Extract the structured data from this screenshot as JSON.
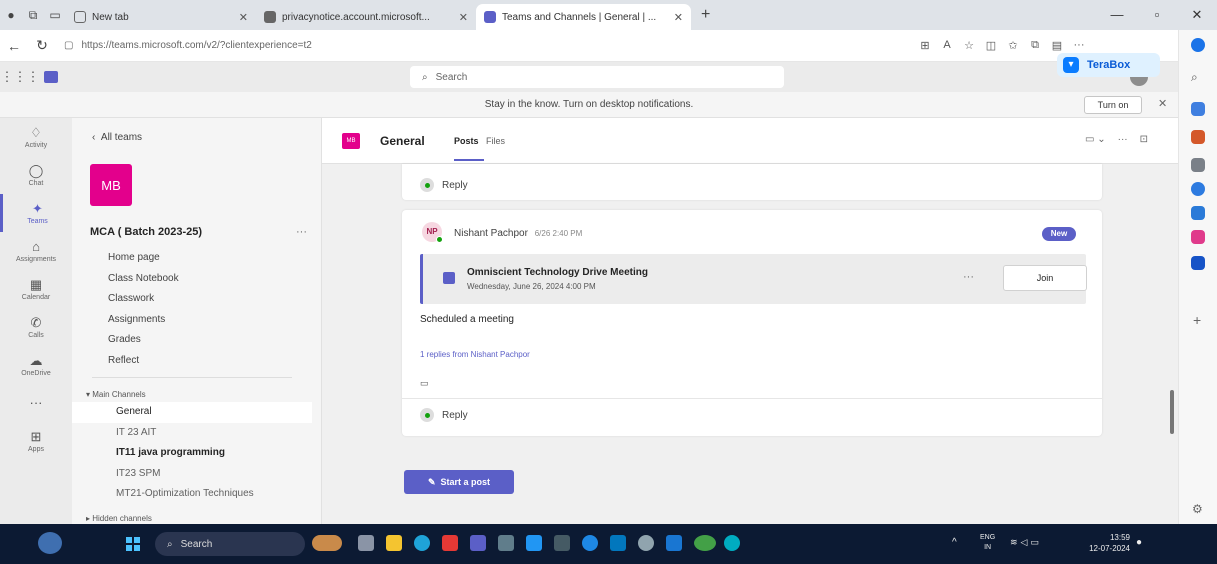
{
  "browser": {
    "tabs": [
      {
        "label": "New tab",
        "active": false
      },
      {
        "label": "privacynotice.account.microsoft...",
        "active": false
      },
      {
        "label": "Teams and Channels | General | ...",
        "active": true
      }
    ],
    "url": "https://teams.microsoft.com/v2/?clientexperience=t2",
    "extension_label": "TeraBox"
  },
  "teams": {
    "search_placeholder": "Search",
    "notification": {
      "text": "Stay in the know. Turn on desktop notifications.",
      "button": "Turn on"
    }
  },
  "rail": [
    {
      "icon": "bell-icon",
      "glyph": "♢",
      "label": "Activity"
    },
    {
      "icon": "chat-icon",
      "glyph": "◯",
      "label": "Chat"
    },
    {
      "icon": "teams-icon",
      "glyph": "✦",
      "label": "Teams",
      "active": true
    },
    {
      "icon": "assignments-icon",
      "glyph": "⌂",
      "label": "Assignments"
    },
    {
      "icon": "calendar-icon",
      "glyph": "▦",
      "label": "Calendar"
    },
    {
      "icon": "calls-icon",
      "glyph": "✆",
      "label": "Calls"
    },
    {
      "icon": "onedrive-icon",
      "glyph": "☁",
      "label": "OneDrive"
    },
    {
      "icon": "more-icon",
      "glyph": "···",
      "label": ""
    },
    {
      "icon": "apps-icon",
      "glyph": "⊞",
      "label": "Apps"
    }
  ],
  "team_panel": {
    "back_label": "All teams",
    "avatar_text": "MB",
    "team_name": "MCA ( Batch 2023-25)",
    "links": [
      "Home page",
      "Class Notebook",
      "Classwork",
      "Assignments",
      "Grades",
      "Reflect"
    ],
    "main_channels_label": "Main Channels",
    "channels": [
      {
        "label": "General",
        "selected": true,
        "bold": false
      },
      {
        "label": "IT 23 AIT",
        "selected": false,
        "bold": false
      },
      {
        "label": "IT11 java programming",
        "selected": false,
        "bold": true
      },
      {
        "label": "IT23 SPM",
        "selected": false,
        "bold": false
      },
      {
        "label": "MT21-Optimization Techniques",
        "selected": false,
        "bold": false
      }
    ],
    "hidden_channels_label": "Hidden channels"
  },
  "channel": {
    "badge": "MB",
    "title": "General",
    "tabs": [
      "Posts",
      "Files"
    ],
    "reply_label": "Reply",
    "post": {
      "author_initials": "NP",
      "author": "Nishant Pachpor",
      "time": "6/26 2:40 PM",
      "badge": "New",
      "meeting_title": "Omniscient Technology Drive Meeting",
      "meeting_date": "Wednesday, June 26, 2024 4:00 PM",
      "join_label": "Join",
      "message": "Scheduled a meeting",
      "replies_link": "1 replies from Nishant Pachpor"
    },
    "start_post_label": "Start a post"
  },
  "taskbar": {
    "search_label": "Search",
    "lang_top": "ENG",
    "lang_bottom": "IN",
    "time": "13:59",
    "date": "12-07-2024"
  },
  "colors": {
    "teams_accent": "#5b5fc7",
    "team_avatar": "#e3008c",
    "taskbar": "#0c1a33"
  }
}
